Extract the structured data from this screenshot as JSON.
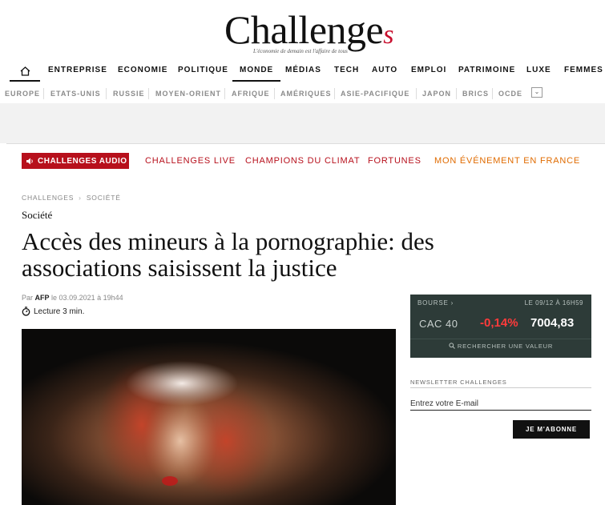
{
  "brand": {
    "logo_main": "Challenge",
    "logo_s": "s",
    "tagline": "L'économie de demain est l'affaire de tous"
  },
  "nav_primary": [
    "ENTREPRISE",
    "ECONOMIE",
    "POLITIQUE",
    "MONDE",
    "MÉDIAS",
    "TECH",
    "AUTO",
    "EMPLOI",
    "PATRIMOINE",
    "LUXE",
    "FEMMES"
  ],
  "nav_secondary": [
    "EUROPE",
    "ETATS-UNIS",
    "RUSSIE",
    "MOYEN-ORIENT",
    "AFRIQUE",
    "AMÉRIQUES",
    "ASIE-PACIFIQUE",
    "JAPON",
    "BRICS",
    "OCDE"
  ],
  "subnav": {
    "audio": "CHALLENGES AUDIO",
    "live": "CHALLENGES LIVE",
    "climat": "CHAMPIONS DU CLIMAT",
    "fortunes": "FORTUNES",
    "event": "MON ÉVÉNEMENT EN FRANCE"
  },
  "article": {
    "breadcrumb": [
      "CHALLENGES",
      "SOCIÉTÉ"
    ],
    "rubric": "Société",
    "title": "Accès des mineurs à la pornographie: des associations saisissent la justice",
    "by_prefix": "Par",
    "author": "AFP",
    "date": "le 03.09.2021 à 19h44",
    "reading": "Lecture 3 min."
  },
  "bourse": {
    "label": "BOURSE",
    "date": "LE 09/12 À 16H59",
    "index": "CAC 40",
    "change": "-0,14%",
    "value": "7004,83",
    "search": "RECHERCHER UNE VALEUR",
    "change_color": "#ff3b3b"
  },
  "newsletter": {
    "label": "NEWSLETTER CHALLENGES",
    "placeholder": "Entrez votre E-mail",
    "button": "JE M'ABONNE"
  },
  "colors": {
    "brand_red": "#b7101c",
    "accent_orange": "#e06b00",
    "bourse_bg": "#2d3b38"
  }
}
